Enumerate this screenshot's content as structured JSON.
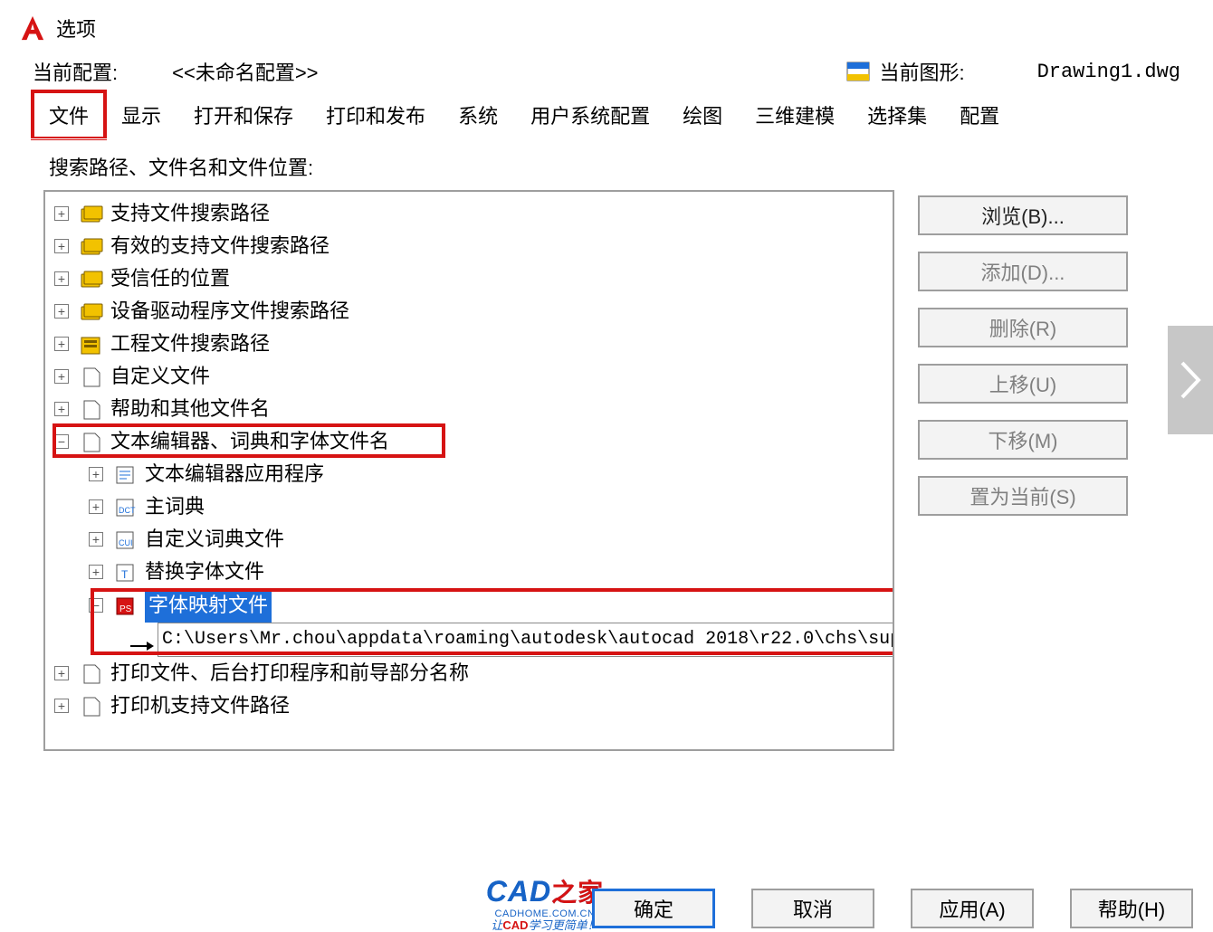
{
  "window": {
    "title": "选项"
  },
  "config": {
    "current_label": "当前配置:",
    "current_value": "<<未命名配置>>",
    "drawing_label": "当前图形:",
    "drawing_value": "Drawing1.dwg"
  },
  "tabs": {
    "file": "文件",
    "display": "显示",
    "open_save": "打开和保存",
    "print_publish": "打印和发布",
    "system": "系统",
    "user_pref": "用户系统配置",
    "drafting": "绘图",
    "modeling_3d": "三维建模",
    "selection": "选择集",
    "profiles": "配置"
  },
  "section_label": "搜索路径、文件名和文件位置:",
  "tree": {
    "support_search_path": "支持文件搜索路径",
    "valid_support_search_path": "有效的支持文件搜索路径",
    "trusted_locations": "受信任的位置",
    "device_driver_search_path": "设备驱动程序文件搜索路径",
    "project_file_search_path": "工程文件搜索路径",
    "custom_files": "自定义文件",
    "help_other_filenames": "帮助和其他文件名",
    "text_editor_dict_font": "文本编辑器、词典和字体文件名",
    "text_editor_app": "文本编辑器应用程序",
    "main_dictionary": "主词典",
    "custom_dictionary_file": "自定义词典文件",
    "alternate_font_file": "替换字体文件",
    "font_mapping_file": "字体映射文件",
    "font_mapping_path": "C:\\Users\\Mr.chou\\appdata\\roaming\\autodesk\\autocad 2018\\r22.0\\chs\\support\\acad.fmp",
    "print_file_names": "打印文件、后台打印程序和前导部分名称",
    "printer_support_path": "打印机支持文件路径"
  },
  "side_buttons": {
    "browse": "浏览(B)...",
    "add": "添加(D)...",
    "remove": "删除(R)",
    "move_up": "上移(U)",
    "move_down": "下移(M)",
    "set_current": "置为当前(S)"
  },
  "footer": {
    "ok": "确定",
    "cancel": "取消",
    "apply": "应用(A)",
    "help": "帮助(H)"
  },
  "watermark": {
    "brand_en": "CAD",
    "brand_zh": "之家",
    "url": "CADHOME.COM.CN",
    "slogan_prefix": "让",
    "slogan_em": "CAD",
    "slogan_suffix": "学习更简单！"
  }
}
